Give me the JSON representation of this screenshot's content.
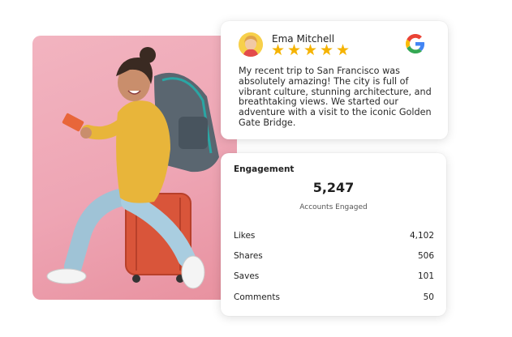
{
  "review": {
    "reviewer_name": "Ema Mitchell",
    "rating": 5,
    "source_icon": "google-icon",
    "text": "My recent trip to San Francisco was absolutely amazing! The city is full of vibrant culture, stunning architecture, and breathtaking views. We started our adventure with a visit to the iconic Golden Gate Bridge.",
    "star_color": "#f5b301"
  },
  "engagement": {
    "title": "Engagement",
    "total": "5,247",
    "total_label": "Accounts Engaged",
    "metrics": [
      {
        "label": "Likes",
        "value": "4,102"
      },
      {
        "label": "Shares",
        "value": "506"
      },
      {
        "label": "Saves",
        "value": "101"
      },
      {
        "label": "Comments",
        "value": "50"
      }
    ]
  },
  "photo": {
    "background_color": "#f0aebb"
  }
}
